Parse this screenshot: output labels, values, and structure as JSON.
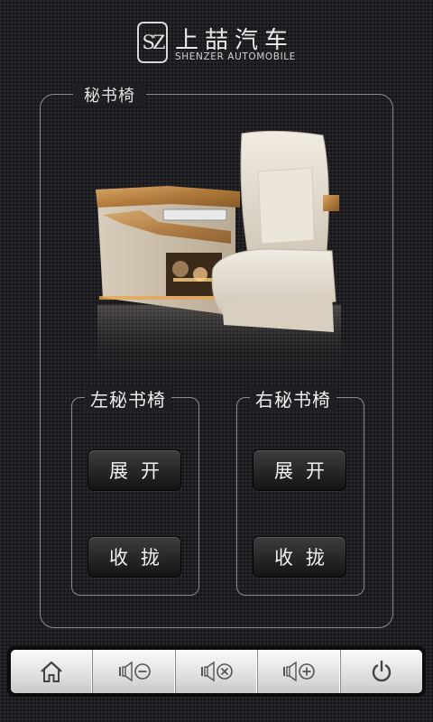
{
  "header": {
    "logo_mark": "SZ",
    "brand_cn": "上喆汽车",
    "brand_en": "SHENZER AUTOMOBILE"
  },
  "panel": {
    "title": "秘书椅",
    "left_group": {
      "title": "左秘书椅",
      "expand_label": "展开",
      "retract_label": "收拢"
    },
    "right_group": {
      "title": "右秘书椅",
      "expand_label": "展开",
      "retract_label": "收拢"
    }
  },
  "toolbar": {
    "items": [
      {
        "icon": "home-icon"
      },
      {
        "icon": "volume-down-icon"
      },
      {
        "icon": "mute-icon"
      },
      {
        "icon": "volume-up-icon"
      },
      {
        "icon": "power-icon"
      }
    ]
  },
  "colors": {
    "background": "#1f1e22",
    "frame_border": "#8b8b8b",
    "button_dark": "#2a2a2c",
    "toolbar_light": "#e4e4e4",
    "wood": "#c08a4a"
  }
}
